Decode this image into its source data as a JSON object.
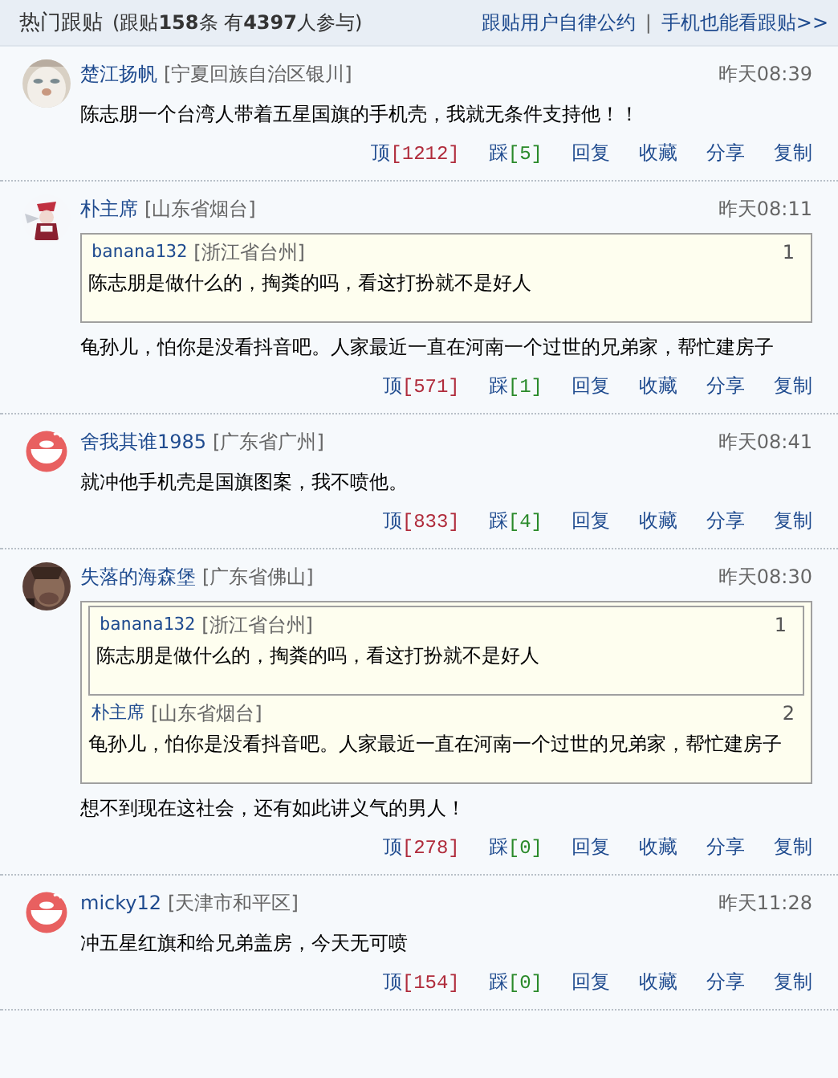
{
  "header": {
    "title": "热门跟贴",
    "stats": "(跟贴**158**条 有**4397**人参与)",
    "links": [
      "跟贴用户自律公约",
      "手机也能看跟贴>>"
    ],
    "separator": "|"
  },
  "comments": [
    {
      "avatar": {
        "kind": "picture"
      },
      "user": "楚江扬帆",
      "location": "[宁夏回族自治区银川]",
      "time": "昨天08:39",
      "text": "陈志朋一个台湾人带着五星国旗的手机壳，我就无条件支持他！！",
      "up": "顶",
      "up_count": "[1212]",
      "down": "踩",
      "down_count": "[5]",
      "actions": [
        "回复",
        "收藏",
        "分享",
        "复制"
      ]
    },
    {
      "avatar": {
        "kind": "picture"
      },
      "user": "朴主席",
      "location": "[山东省烟台]",
      "time": "昨天08:11",
      "quotes": [
        {
          "user": "banana132",
          "location": "[浙江省台州]",
          "floor": "1",
          "text": "陈志朋是做什么的，掏粪的吗，看这打扮就不是好人"
        }
      ],
      "text": "龟孙儿，怕你是没看抖音吧。人家最近一直在河南一个过世的兄弟家，帮忙建房子",
      "up": "顶",
      "up_count": "[571]",
      "down": "踩",
      "down_count": "[1]",
      "actions": [
        "回复",
        "收藏",
        "分享",
        "复制"
      ]
    },
    {
      "avatar": {
        "kind": "default"
      },
      "user": "舍我其谁1985",
      "location": "[广东省广州]",
      "time": "昨天08:41",
      "text": "就冲他手机壳是国旗图案，我不喷他。",
      "up": "顶",
      "up_count": "[833]",
      "down": "踩",
      "down_count": "[4]",
      "actions": [
        "回复",
        "收藏",
        "分享",
        "复制"
      ]
    },
    {
      "avatar": {
        "kind": "picture"
      },
      "user": "失落的海森堡",
      "location": "[广东省佛山]",
      "time": "昨天08:30",
      "quotes": [
        {
          "user": "banana132",
          "location": "[浙江省台州]",
          "floor": "1",
          "text": "陈志朋是做什么的，掏粪的吗，看这打扮就不是好人"
        },
        {
          "user": "朴主席",
          "location": "[山东省烟台]",
          "floor": "2",
          "text": "龟孙儿，怕你是没看抖音吧。人家最近一直在河南一个过世的兄弟家，帮忙建房子"
        }
      ],
      "text": "想不到现在这社会，还有如此讲义气的男人！",
      "up": "顶",
      "up_count": "[278]",
      "down": "踩",
      "down_count": "[0]",
      "actions": [
        "回复",
        "收藏",
        "分享",
        "复制"
      ]
    },
    {
      "avatar": {
        "kind": "default"
      },
      "user": "micky12",
      "location": "[天津市和平区]",
      "time": "昨天11:28",
      "text": "冲五星红旗和给兄弟盖房，今天无可喷",
      "up": "顶",
      "up_count": "[154]",
      "down": "踩",
      "down_count": "[0]",
      "actions": [
        "回复",
        "收藏",
        "分享",
        "复制"
      ]
    }
  ]
}
